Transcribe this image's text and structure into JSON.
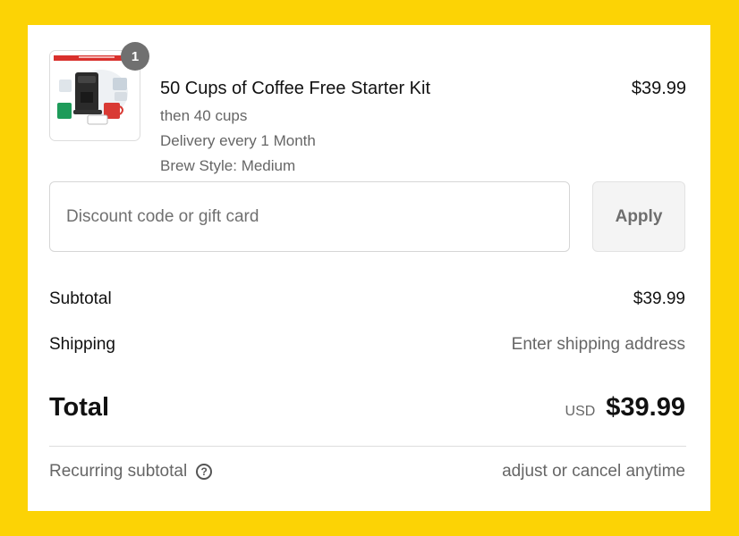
{
  "colors": {
    "background": "#fcd305",
    "card": "#ffffff",
    "badge": "#707070",
    "muted_text": "#666666"
  },
  "line_item": {
    "quantity": "1",
    "title": "50 Cups of Coffee Free Starter Kit",
    "details": [
      "then 40 cups",
      "Delivery every 1 Month",
      "Brew Style: Medium"
    ],
    "price": "$39.99",
    "image_icon": "coffee-starter-kit-image"
  },
  "discount": {
    "placeholder": "Discount code or gift card",
    "value": "",
    "apply_label": "Apply"
  },
  "summary": {
    "subtotal_label": "Subtotal",
    "subtotal_value": "$39.99",
    "shipping_label": "Shipping",
    "shipping_value": "Enter shipping address",
    "total_label": "Total",
    "currency": "USD",
    "total_value": "$39.99",
    "recurring_label": "Recurring subtotal",
    "help_icon": "question-circle-icon",
    "recurring_note": "adjust or cancel anytime"
  }
}
